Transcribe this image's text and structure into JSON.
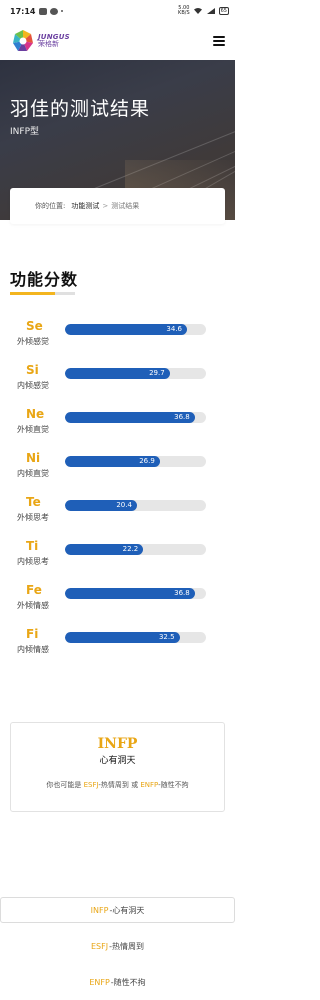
{
  "status_bar": {
    "time": "17:14",
    "network_speed": "5.00",
    "network_unit": "KB/S",
    "battery": "65"
  },
  "header": {
    "logo_en": "JUNGUS",
    "logo_zh": "荣格新",
    "menu_icon": "hamburger-menu-icon"
  },
  "hero": {
    "title": "羽佳的测试结果",
    "subtitle": "INFP型"
  },
  "breadcrumb": {
    "prefix": "你的位置:",
    "home": "功能测试",
    "separator": ">",
    "current": "测试结果"
  },
  "section": {
    "title": "功能分数"
  },
  "chart_data": {
    "type": "bar",
    "orientation": "horizontal",
    "categories": [
      "Se",
      "Si",
      "Ne",
      "Ni",
      "Te",
      "Ti",
      "Fe",
      "Fi"
    ],
    "category_labels": [
      "外倾感觉",
      "内倾感觉",
      "外倾直觉",
      "内倾直觉",
      "外倾思考",
      "内倾思考",
      "外倾情感",
      "内倾情感"
    ],
    "values": [
      34.6,
      29.7,
      36.8,
      26.9,
      20.4,
      22.2,
      36.8,
      32.5
    ],
    "xlim": [
      0,
      40
    ],
    "bar_color": "#1f5fb8",
    "track_color": "#e6e6e6",
    "label_color": "#e9a615"
  },
  "result": {
    "type": "INFP",
    "name": "心有洞天",
    "alt_prefix": "你也可能是",
    "alt1_code": "ESFJ",
    "alt1_name": "-热情周到",
    "alt_or": "或",
    "alt2_code": "ENFP",
    "alt2_name": "-随性不拘"
  },
  "type_list": [
    {
      "code": "INFP",
      "name": "-心有洞天"
    },
    {
      "code": "ESFJ",
      "name": "-热情周到"
    },
    {
      "code": "ENFP",
      "name": "-随性不拘"
    }
  ],
  "colors": {
    "accent": "#e9a615",
    "bar": "#1f5fb8",
    "hero_bg": "#363845"
  }
}
